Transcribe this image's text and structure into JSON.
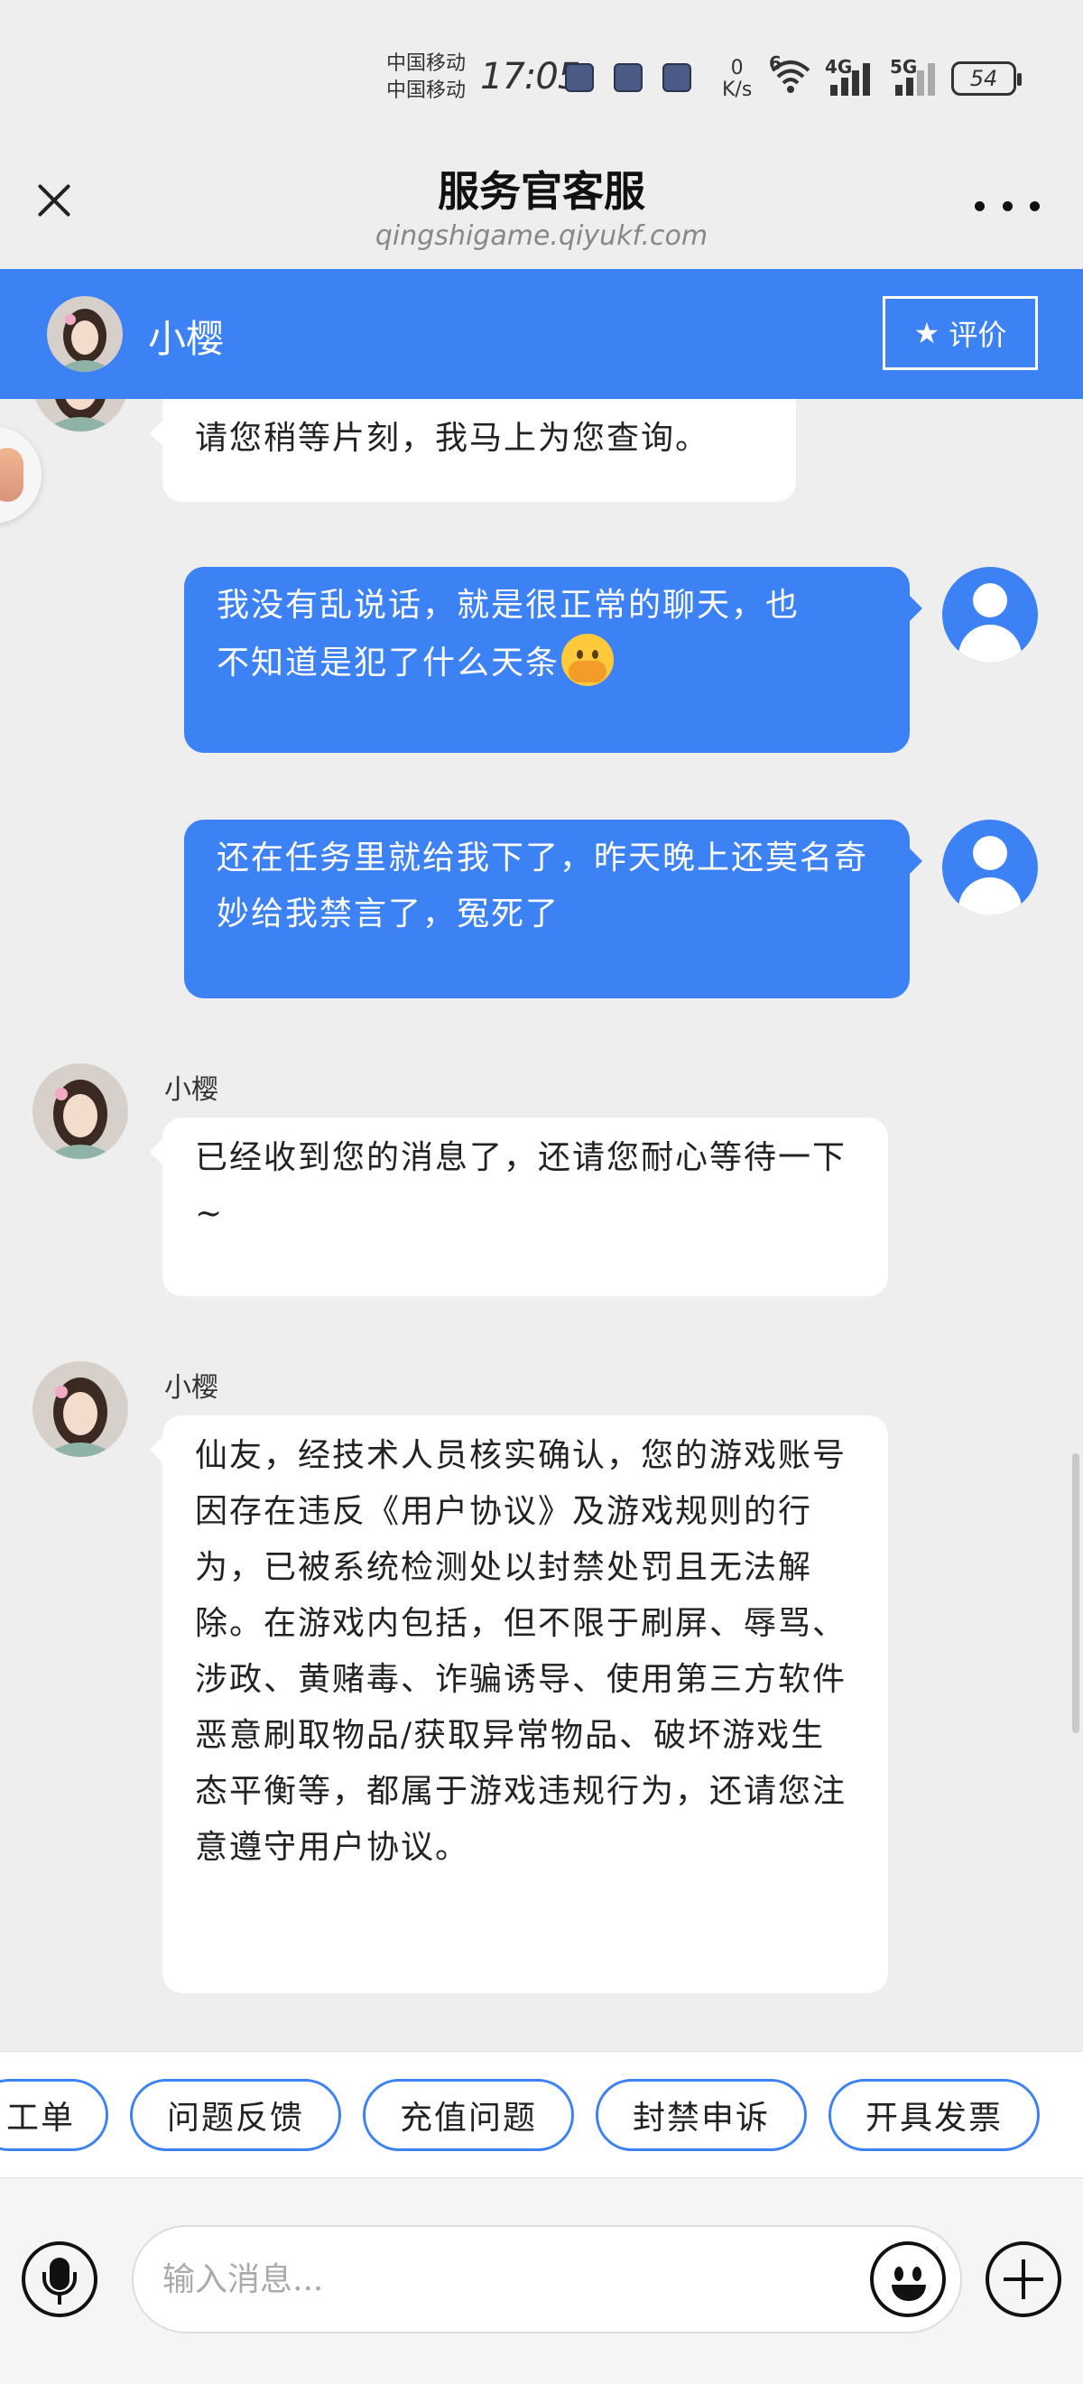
{
  "status_bar": {
    "carrier_1": "中国移动",
    "carrier_2": "中国移动",
    "time": "17:05",
    "speed_value": "0",
    "speed_unit": "K/s",
    "signal_1": "6",
    "signal_2": "4G",
    "signal_3": "5G",
    "battery": "54"
  },
  "header": {
    "title": "服务官客服",
    "subtitle": "qingshigame.qiyukf.com"
  },
  "agent_bar": {
    "name": "小樱",
    "rate_label": "评价"
  },
  "messages": [
    {
      "from": "agent",
      "sender": "",
      "text": "请您稍等片刻，我马上为您查询。"
    },
    {
      "from": "user",
      "line_1": "我没有乱说话，就是很正常的聊天，也",
      "line_2": "不知道是犯了什么天条",
      "emoji": "face-with-hand-over-mouth"
    },
    {
      "from": "user",
      "text": "还在任务里就给我下了，昨天晚上还莫名奇妙给我禁言了，冤死了"
    },
    {
      "from": "agent",
      "sender": "小樱",
      "text": "已经收到您的消息了，还请您耐心等待一下~"
    },
    {
      "from": "agent",
      "sender": "小樱",
      "text": "仙友，经技术人员核实确认，您的游戏账号因存在违反《用户协议》及游戏规则的行为，已被系统检测处以封禁处罚且无法解除。在游戏内包括，但不限于刷屏、辱骂、涉政、黄赌毒、诈骗诱导、使用第三方软件恶意刷取物品/获取异常物品、破坏游戏生态平衡等，都属于游戏违规行为，还请您注意遵守用户协议。"
    }
  ],
  "quick_replies": [
    "工单",
    "问题反馈",
    "充值问题",
    "封禁申诉",
    "开具发票"
  ],
  "input": {
    "placeholder": "输入消息..."
  },
  "colors": {
    "accent": "#3d82f4",
    "background": "#eeeeee",
    "bubble_in": "#ffffff"
  }
}
